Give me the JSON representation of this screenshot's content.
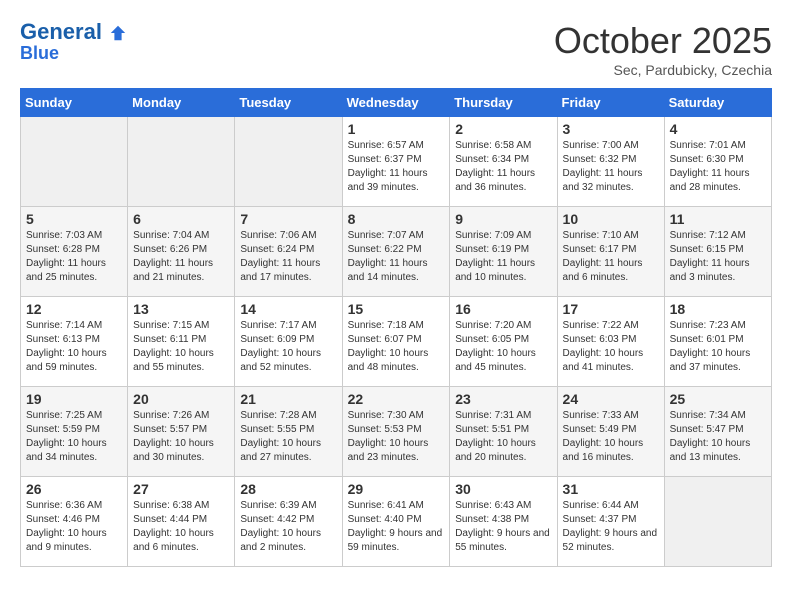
{
  "header": {
    "logo_line1": "General",
    "logo_line2": "Blue",
    "month": "October 2025",
    "location": "Sec, Pardubicky, Czechia"
  },
  "weekdays": [
    "Sunday",
    "Monday",
    "Tuesday",
    "Wednesday",
    "Thursday",
    "Friday",
    "Saturday"
  ],
  "weeks": [
    [
      null,
      null,
      null,
      {
        "day": 1,
        "sunrise": "6:57 AM",
        "sunset": "6:37 PM",
        "daylight": "11 hours and 39 minutes."
      },
      {
        "day": 2,
        "sunrise": "6:58 AM",
        "sunset": "6:34 PM",
        "daylight": "11 hours and 36 minutes."
      },
      {
        "day": 3,
        "sunrise": "7:00 AM",
        "sunset": "6:32 PM",
        "daylight": "11 hours and 32 minutes."
      },
      {
        "day": 4,
        "sunrise": "7:01 AM",
        "sunset": "6:30 PM",
        "daylight": "11 hours and 28 minutes."
      }
    ],
    [
      {
        "day": 5,
        "sunrise": "7:03 AM",
        "sunset": "6:28 PM",
        "daylight": "11 hours and 25 minutes."
      },
      {
        "day": 6,
        "sunrise": "7:04 AM",
        "sunset": "6:26 PM",
        "daylight": "11 hours and 21 minutes."
      },
      {
        "day": 7,
        "sunrise": "7:06 AM",
        "sunset": "6:24 PM",
        "daylight": "11 hours and 17 minutes."
      },
      {
        "day": 8,
        "sunrise": "7:07 AM",
        "sunset": "6:22 PM",
        "daylight": "11 hours and 14 minutes."
      },
      {
        "day": 9,
        "sunrise": "7:09 AM",
        "sunset": "6:19 PM",
        "daylight": "11 hours and 10 minutes."
      },
      {
        "day": 10,
        "sunrise": "7:10 AM",
        "sunset": "6:17 PM",
        "daylight": "11 hours and 6 minutes."
      },
      {
        "day": 11,
        "sunrise": "7:12 AM",
        "sunset": "6:15 PM",
        "daylight": "11 hours and 3 minutes."
      }
    ],
    [
      {
        "day": 12,
        "sunrise": "7:14 AM",
        "sunset": "6:13 PM",
        "daylight": "10 hours and 59 minutes."
      },
      {
        "day": 13,
        "sunrise": "7:15 AM",
        "sunset": "6:11 PM",
        "daylight": "10 hours and 55 minutes."
      },
      {
        "day": 14,
        "sunrise": "7:17 AM",
        "sunset": "6:09 PM",
        "daylight": "10 hours and 52 minutes."
      },
      {
        "day": 15,
        "sunrise": "7:18 AM",
        "sunset": "6:07 PM",
        "daylight": "10 hours and 48 minutes."
      },
      {
        "day": 16,
        "sunrise": "7:20 AM",
        "sunset": "6:05 PM",
        "daylight": "10 hours and 45 minutes."
      },
      {
        "day": 17,
        "sunrise": "7:22 AM",
        "sunset": "6:03 PM",
        "daylight": "10 hours and 41 minutes."
      },
      {
        "day": 18,
        "sunrise": "7:23 AM",
        "sunset": "6:01 PM",
        "daylight": "10 hours and 37 minutes."
      }
    ],
    [
      {
        "day": 19,
        "sunrise": "7:25 AM",
        "sunset": "5:59 PM",
        "daylight": "10 hours and 34 minutes."
      },
      {
        "day": 20,
        "sunrise": "7:26 AM",
        "sunset": "5:57 PM",
        "daylight": "10 hours and 30 minutes."
      },
      {
        "day": 21,
        "sunrise": "7:28 AM",
        "sunset": "5:55 PM",
        "daylight": "10 hours and 27 minutes."
      },
      {
        "day": 22,
        "sunrise": "7:30 AM",
        "sunset": "5:53 PM",
        "daylight": "10 hours and 23 minutes."
      },
      {
        "day": 23,
        "sunrise": "7:31 AM",
        "sunset": "5:51 PM",
        "daylight": "10 hours and 20 minutes."
      },
      {
        "day": 24,
        "sunrise": "7:33 AM",
        "sunset": "5:49 PM",
        "daylight": "10 hours and 16 minutes."
      },
      {
        "day": 25,
        "sunrise": "7:34 AM",
        "sunset": "5:47 PM",
        "daylight": "10 hours and 13 minutes."
      }
    ],
    [
      {
        "day": 26,
        "sunrise": "6:36 AM",
        "sunset": "4:46 PM",
        "daylight": "10 hours and 9 minutes."
      },
      {
        "day": 27,
        "sunrise": "6:38 AM",
        "sunset": "4:44 PM",
        "daylight": "10 hours and 6 minutes."
      },
      {
        "day": 28,
        "sunrise": "6:39 AM",
        "sunset": "4:42 PM",
        "daylight": "10 hours and 2 minutes."
      },
      {
        "day": 29,
        "sunrise": "6:41 AM",
        "sunset": "4:40 PM",
        "daylight": "9 hours and 59 minutes."
      },
      {
        "day": 30,
        "sunrise": "6:43 AM",
        "sunset": "4:38 PM",
        "daylight": "9 hours and 55 minutes."
      },
      {
        "day": 31,
        "sunrise": "6:44 AM",
        "sunset": "4:37 PM",
        "daylight": "9 hours and 52 minutes."
      },
      null
    ]
  ]
}
